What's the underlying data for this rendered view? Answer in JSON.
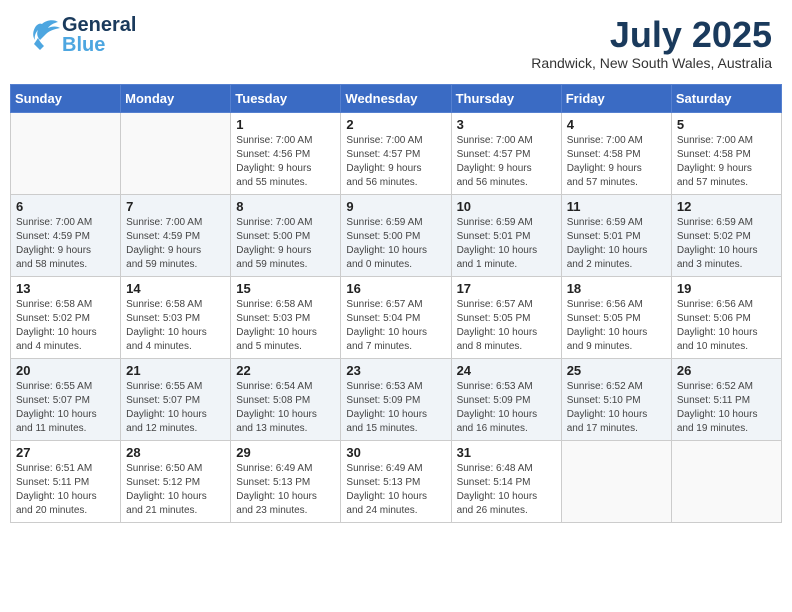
{
  "header": {
    "logo_general": "General",
    "logo_blue": "Blue",
    "month_year": "July 2025",
    "location": "Randwick, New South Wales, Australia"
  },
  "days_of_week": [
    "Sunday",
    "Monday",
    "Tuesday",
    "Wednesday",
    "Thursday",
    "Friday",
    "Saturday"
  ],
  "weeks": [
    [
      {
        "day": "",
        "info": ""
      },
      {
        "day": "",
        "info": ""
      },
      {
        "day": "1",
        "info": "Sunrise: 7:00 AM\nSunset: 4:56 PM\nDaylight: 9 hours\nand 55 minutes."
      },
      {
        "day": "2",
        "info": "Sunrise: 7:00 AM\nSunset: 4:57 PM\nDaylight: 9 hours\nand 56 minutes."
      },
      {
        "day": "3",
        "info": "Sunrise: 7:00 AM\nSunset: 4:57 PM\nDaylight: 9 hours\nand 56 minutes."
      },
      {
        "day": "4",
        "info": "Sunrise: 7:00 AM\nSunset: 4:58 PM\nDaylight: 9 hours\nand 57 minutes."
      },
      {
        "day": "5",
        "info": "Sunrise: 7:00 AM\nSunset: 4:58 PM\nDaylight: 9 hours\nand 57 minutes."
      }
    ],
    [
      {
        "day": "6",
        "info": "Sunrise: 7:00 AM\nSunset: 4:59 PM\nDaylight: 9 hours\nand 58 minutes."
      },
      {
        "day": "7",
        "info": "Sunrise: 7:00 AM\nSunset: 4:59 PM\nDaylight: 9 hours\nand 59 minutes."
      },
      {
        "day": "8",
        "info": "Sunrise: 7:00 AM\nSunset: 5:00 PM\nDaylight: 9 hours\nand 59 minutes."
      },
      {
        "day": "9",
        "info": "Sunrise: 6:59 AM\nSunset: 5:00 PM\nDaylight: 10 hours\nand 0 minutes."
      },
      {
        "day": "10",
        "info": "Sunrise: 6:59 AM\nSunset: 5:01 PM\nDaylight: 10 hours\nand 1 minute."
      },
      {
        "day": "11",
        "info": "Sunrise: 6:59 AM\nSunset: 5:01 PM\nDaylight: 10 hours\nand 2 minutes."
      },
      {
        "day": "12",
        "info": "Sunrise: 6:59 AM\nSunset: 5:02 PM\nDaylight: 10 hours\nand 3 minutes."
      }
    ],
    [
      {
        "day": "13",
        "info": "Sunrise: 6:58 AM\nSunset: 5:02 PM\nDaylight: 10 hours\nand 4 minutes."
      },
      {
        "day": "14",
        "info": "Sunrise: 6:58 AM\nSunset: 5:03 PM\nDaylight: 10 hours\nand 4 minutes."
      },
      {
        "day": "15",
        "info": "Sunrise: 6:58 AM\nSunset: 5:03 PM\nDaylight: 10 hours\nand 5 minutes."
      },
      {
        "day": "16",
        "info": "Sunrise: 6:57 AM\nSunset: 5:04 PM\nDaylight: 10 hours\nand 7 minutes."
      },
      {
        "day": "17",
        "info": "Sunrise: 6:57 AM\nSunset: 5:05 PM\nDaylight: 10 hours\nand 8 minutes."
      },
      {
        "day": "18",
        "info": "Sunrise: 6:56 AM\nSunset: 5:05 PM\nDaylight: 10 hours\nand 9 minutes."
      },
      {
        "day": "19",
        "info": "Sunrise: 6:56 AM\nSunset: 5:06 PM\nDaylight: 10 hours\nand 10 minutes."
      }
    ],
    [
      {
        "day": "20",
        "info": "Sunrise: 6:55 AM\nSunset: 5:07 PM\nDaylight: 10 hours\nand 11 minutes."
      },
      {
        "day": "21",
        "info": "Sunrise: 6:55 AM\nSunset: 5:07 PM\nDaylight: 10 hours\nand 12 minutes."
      },
      {
        "day": "22",
        "info": "Sunrise: 6:54 AM\nSunset: 5:08 PM\nDaylight: 10 hours\nand 13 minutes."
      },
      {
        "day": "23",
        "info": "Sunrise: 6:53 AM\nSunset: 5:09 PM\nDaylight: 10 hours\nand 15 minutes."
      },
      {
        "day": "24",
        "info": "Sunrise: 6:53 AM\nSunset: 5:09 PM\nDaylight: 10 hours\nand 16 minutes."
      },
      {
        "day": "25",
        "info": "Sunrise: 6:52 AM\nSunset: 5:10 PM\nDaylight: 10 hours\nand 17 minutes."
      },
      {
        "day": "26",
        "info": "Sunrise: 6:52 AM\nSunset: 5:11 PM\nDaylight: 10 hours\nand 19 minutes."
      }
    ],
    [
      {
        "day": "27",
        "info": "Sunrise: 6:51 AM\nSunset: 5:11 PM\nDaylight: 10 hours\nand 20 minutes."
      },
      {
        "day": "28",
        "info": "Sunrise: 6:50 AM\nSunset: 5:12 PM\nDaylight: 10 hours\nand 21 minutes."
      },
      {
        "day": "29",
        "info": "Sunrise: 6:49 AM\nSunset: 5:13 PM\nDaylight: 10 hours\nand 23 minutes."
      },
      {
        "day": "30",
        "info": "Sunrise: 6:49 AM\nSunset: 5:13 PM\nDaylight: 10 hours\nand 24 minutes."
      },
      {
        "day": "31",
        "info": "Sunrise: 6:48 AM\nSunset: 5:14 PM\nDaylight: 10 hours\nand 26 minutes."
      },
      {
        "day": "",
        "info": ""
      },
      {
        "day": "",
        "info": ""
      }
    ]
  ]
}
